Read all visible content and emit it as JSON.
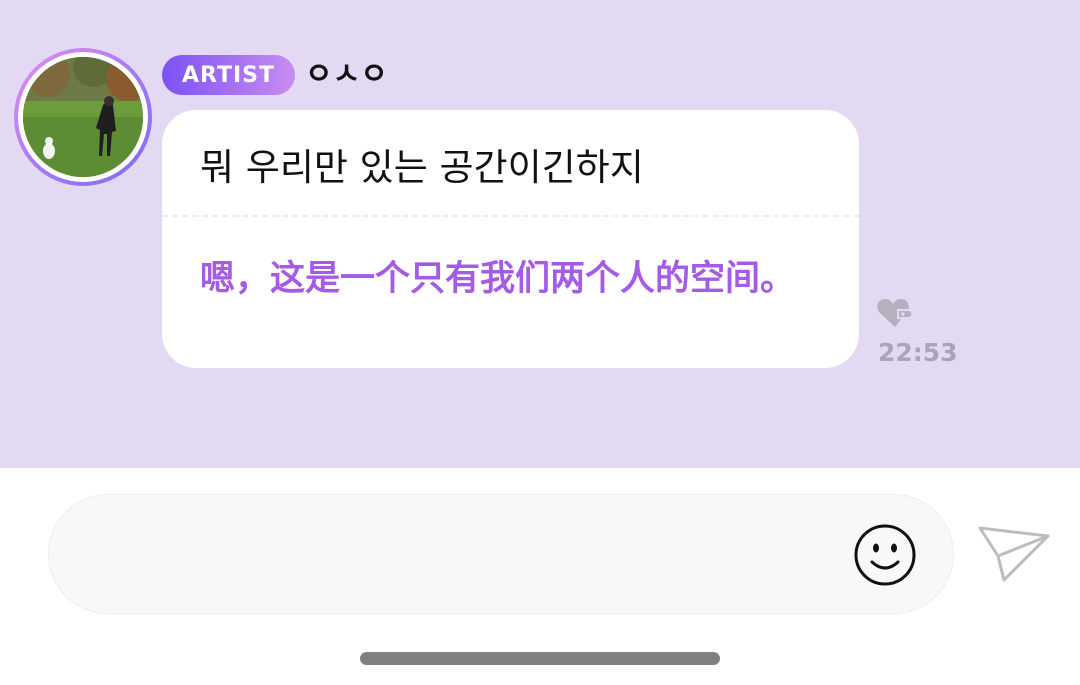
{
  "sender": {
    "badge": "ARTIST",
    "name": "ㅇㅅㅇ"
  },
  "message": {
    "original": "뭐 우리만 있는 공간이긴하지",
    "translation": "嗯，这是一个只有我们两个人的空间。",
    "time": "22:53"
  },
  "icons": {
    "like": "heart-tag-icon",
    "emoji": "smiley-icon",
    "send": "paper-plane-icon"
  },
  "colors": {
    "chat_background": "#e4d9f3",
    "translation_text": "#a45be6",
    "badge_start": "#7b52f5",
    "badge_end": "#c98cf2"
  }
}
